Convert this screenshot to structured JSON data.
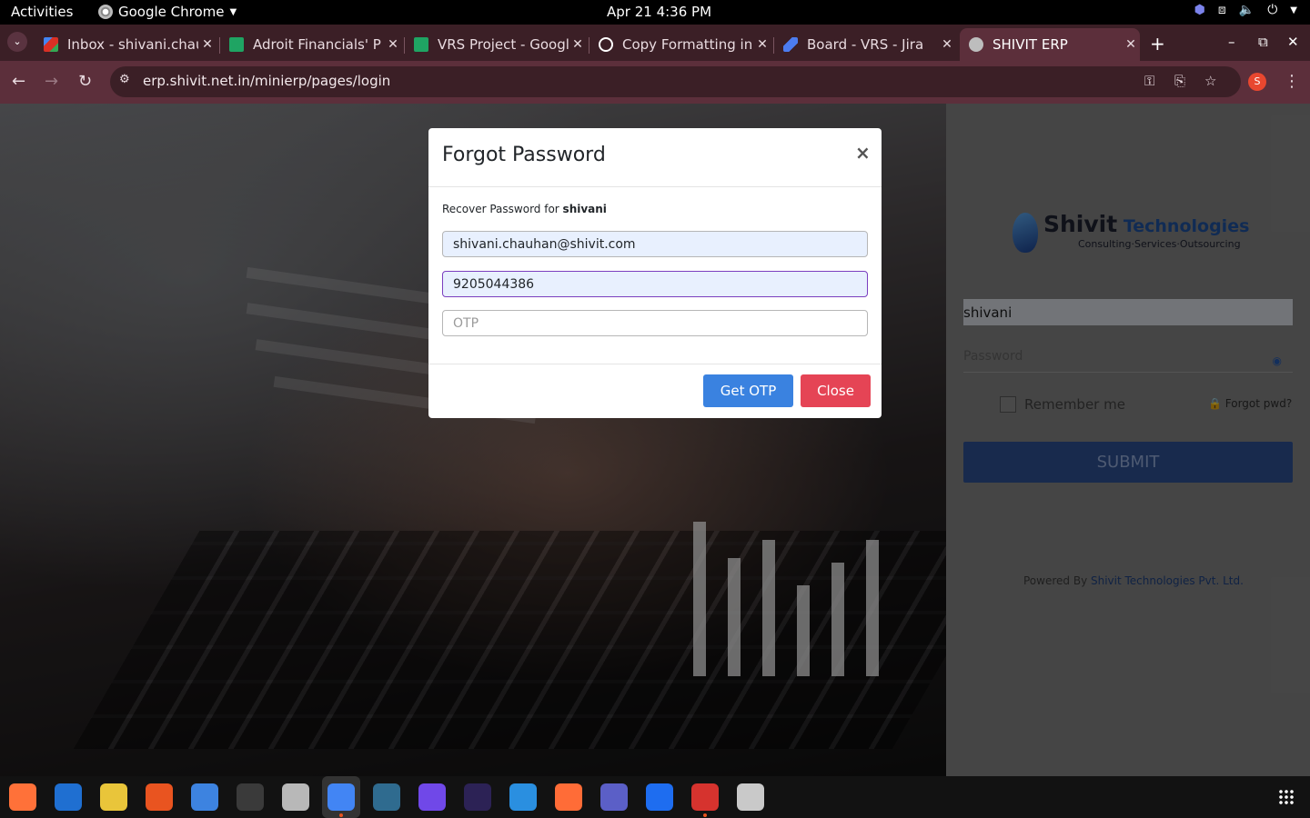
{
  "system": {
    "activities": "Activities",
    "app_name": "Google Chrome",
    "clock": "Apr 21  4:36 PM"
  },
  "tabs": [
    {
      "title": "Inbox - shivani.chau",
      "favicon": "gmail-icon",
      "color": "#d93025"
    },
    {
      "title": "Adroit Financials' P",
      "favicon": "sheets-icon",
      "color": "#1fa463"
    },
    {
      "title": "VRS Project - Googl",
      "favicon": "sheets-icon",
      "color": "#1fa463"
    },
    {
      "title": "Copy Formatting in",
      "favicon": "openai-icon",
      "color": "#ffffff"
    },
    {
      "title": "Board - VRS - Jira",
      "favicon": "jira-icon",
      "color": "#4c7cf0"
    },
    {
      "title": "SHIVIT ERP",
      "favicon": "globe-icon",
      "color": "#bdbdbd"
    }
  ],
  "address_bar": {
    "url": "erp.shivit.net.in/minierp/pages/login",
    "profile_initial": "S"
  },
  "modal": {
    "title": "Forgot Password",
    "close_glyph": "×",
    "recover_prefix": "Recover Password for ",
    "recover_user": "shivani",
    "email_value": "shivani.chauhan@shivit.com",
    "mobile_value": "9205044386",
    "otp_placeholder": "OTP",
    "get_otp_label": "Get OTP",
    "close_label": "Close"
  },
  "login": {
    "logo_name": "Shivit",
    "logo_name_suffix": " Technologies",
    "logo_tagline": "Consulting·Services·Outsourcing",
    "username_value": "shivani",
    "password_placeholder": "Password",
    "remember_label": "Remember me",
    "forgot_label": "🔒 Forgot pwd?",
    "submit_label": "SUBMIT",
    "powered_prefix": "Powered By ",
    "powered_link": "Shivit Technologies Pvt. Ltd."
  },
  "dock": [
    {
      "name": "firefox-icon",
      "color": "#ff7139"
    },
    {
      "name": "thunderbird-icon",
      "color": "#1f6fd1"
    },
    {
      "name": "rhythmbox-icon",
      "color": "#e9c53a"
    },
    {
      "name": "app-center-icon",
      "color": "#e95420"
    },
    {
      "name": "text-editor-icon",
      "color": "#3d83e0"
    },
    {
      "name": "terminal-icon",
      "color": "#3a3a3a"
    },
    {
      "name": "files-icon",
      "color": "#b8b8b8"
    },
    {
      "name": "chrome-icon",
      "color": "#4285f4"
    },
    {
      "name": "mysql-workbench-icon",
      "color": "#2f6b8f"
    },
    {
      "name": "github-desktop-icon",
      "color": "#7048e8"
    },
    {
      "name": "eclipse-icon",
      "color": "#2c2255"
    },
    {
      "name": "vscode-icon",
      "color": "#2a8fe0"
    },
    {
      "name": "postman-icon",
      "color": "#ff6c37"
    },
    {
      "name": "teams-icon",
      "color": "#5b5fc7"
    },
    {
      "name": "intellij-icon",
      "color": "#1e6df0"
    },
    {
      "name": "wps-office-icon",
      "color": "#d6332e"
    },
    {
      "name": "image-viewer-icon",
      "color": "#c9c9c9"
    }
  ]
}
